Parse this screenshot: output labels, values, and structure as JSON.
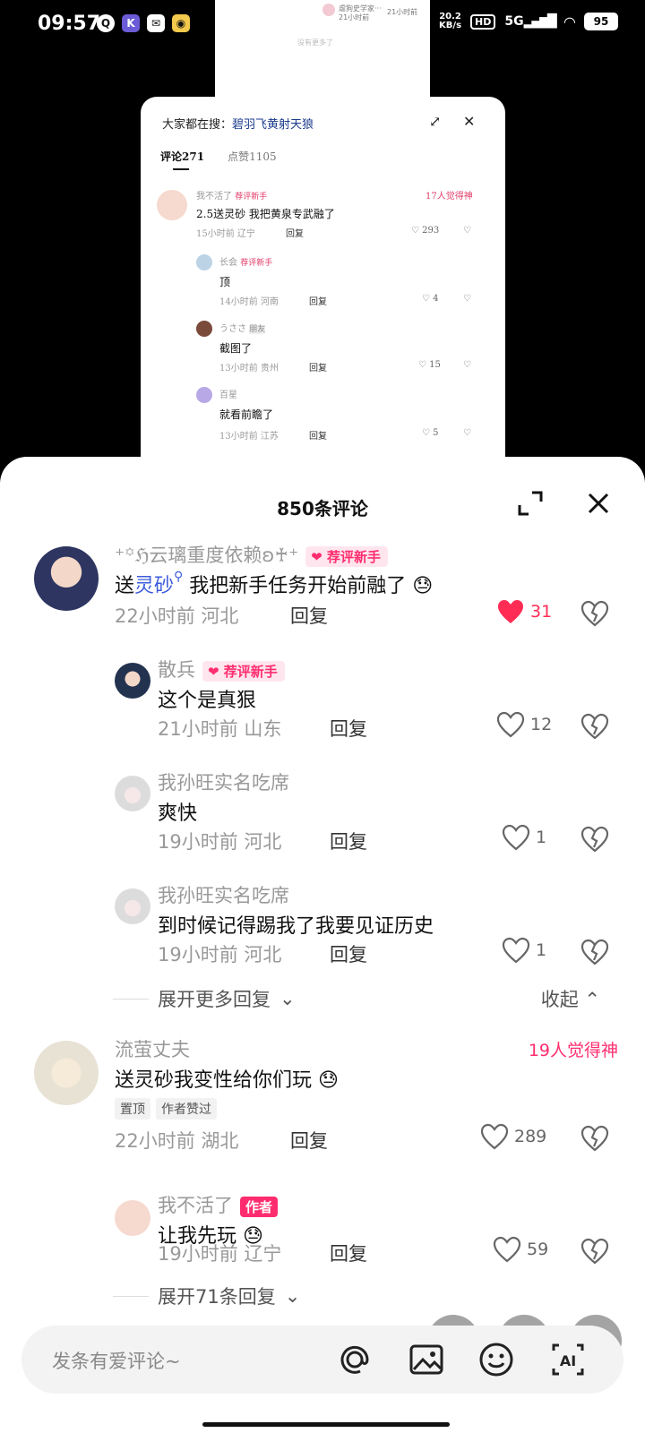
{
  "status_bar": {
    "time": "09:57",
    "net_speed_value": "20.2",
    "net_speed_unit": "KB/s",
    "hd": "HD",
    "signal": "5G",
    "battery": "95"
  },
  "background_screenshot": {
    "top_user": "虐狗史学家···",
    "top_time1": "21小时前",
    "top_time2": "21小时前",
    "no_more": "没有更多了",
    "search": "大家都在搜：",
    "search_term": "碧羽飞黄射天狼",
    "tab_comments": "评论271",
    "tab_likes": "点赞1105",
    "comments": [
      {
        "name": "我不活了",
        "badge": "荐评新手",
        "hot": "17人觉得神",
        "text": "2.5送灵砂 我把黄泉专武融了",
        "time": "15小时前 辽宁",
        "reply": "回复",
        "likes": "293"
      },
      {
        "name": "长会",
        "badge": "荐评新手",
        "text": "顶",
        "time": "14小时前 河南",
        "reply": "回复",
        "likes": "4"
      },
      {
        "name": "うささ",
        "badge": "朋友",
        "text": "截图了",
        "time": "13小时前 贵州",
        "reply": "回复",
        "likes": "15"
      },
      {
        "name": "百星",
        "text": "就看前瞻了",
        "time": "13小时前 江苏",
        "reply": "回复",
        "likes": "5"
      }
    ]
  },
  "sheet": {
    "title": "850条评论",
    "comments": [
      {
        "name": "⁺꙳ℌ云璃重度依赖ʚ♰⁺",
        "badge": "荐评新手",
        "text_prefix": "送",
        "text_link": "灵砂",
        "text_suffix": " 我把新手任务开始前融了",
        "time": "22小时前 河北",
        "reply": "回复",
        "likes": "31",
        "liked": true
      },
      {
        "name": "散兵",
        "badge": "荐评新手",
        "text": "这个是真狠",
        "time": "21小时前 山东",
        "reply": "回复",
        "likes": "12"
      },
      {
        "name": "我孙旺实名吃席",
        "text": "爽快",
        "time": "19小时前 河北",
        "reply": "回复",
        "likes": "1"
      },
      {
        "name": "我孙旺实名吃席",
        "text": "到时候记得踢我了我要见证历史",
        "time": "19小时前 河北",
        "reply": "回复",
        "likes": "1"
      },
      {
        "name": "流萤丈夫",
        "hot": "19人觉得神",
        "text": "送灵砂我变性给你们玩",
        "tags": [
          "置顶",
          "作者赞过"
        ],
        "time": "22小时前 湖北",
        "reply": "回复",
        "likes": "289"
      },
      {
        "name": "我不活了",
        "badge": "作者",
        "text": "让我先玩",
        "time": "19小时前 辽宁",
        "reply": "回复",
        "likes": "59"
      }
    ],
    "expand_more": "展开更多回复",
    "collapse": "收起",
    "expand_71": "展开71条回复"
  },
  "input": {
    "placeholder": "发条有爱评论~"
  },
  "colors": {
    "accent": "#ff2d6f",
    "link": "#3b5bdb",
    "muted": "#999999"
  }
}
